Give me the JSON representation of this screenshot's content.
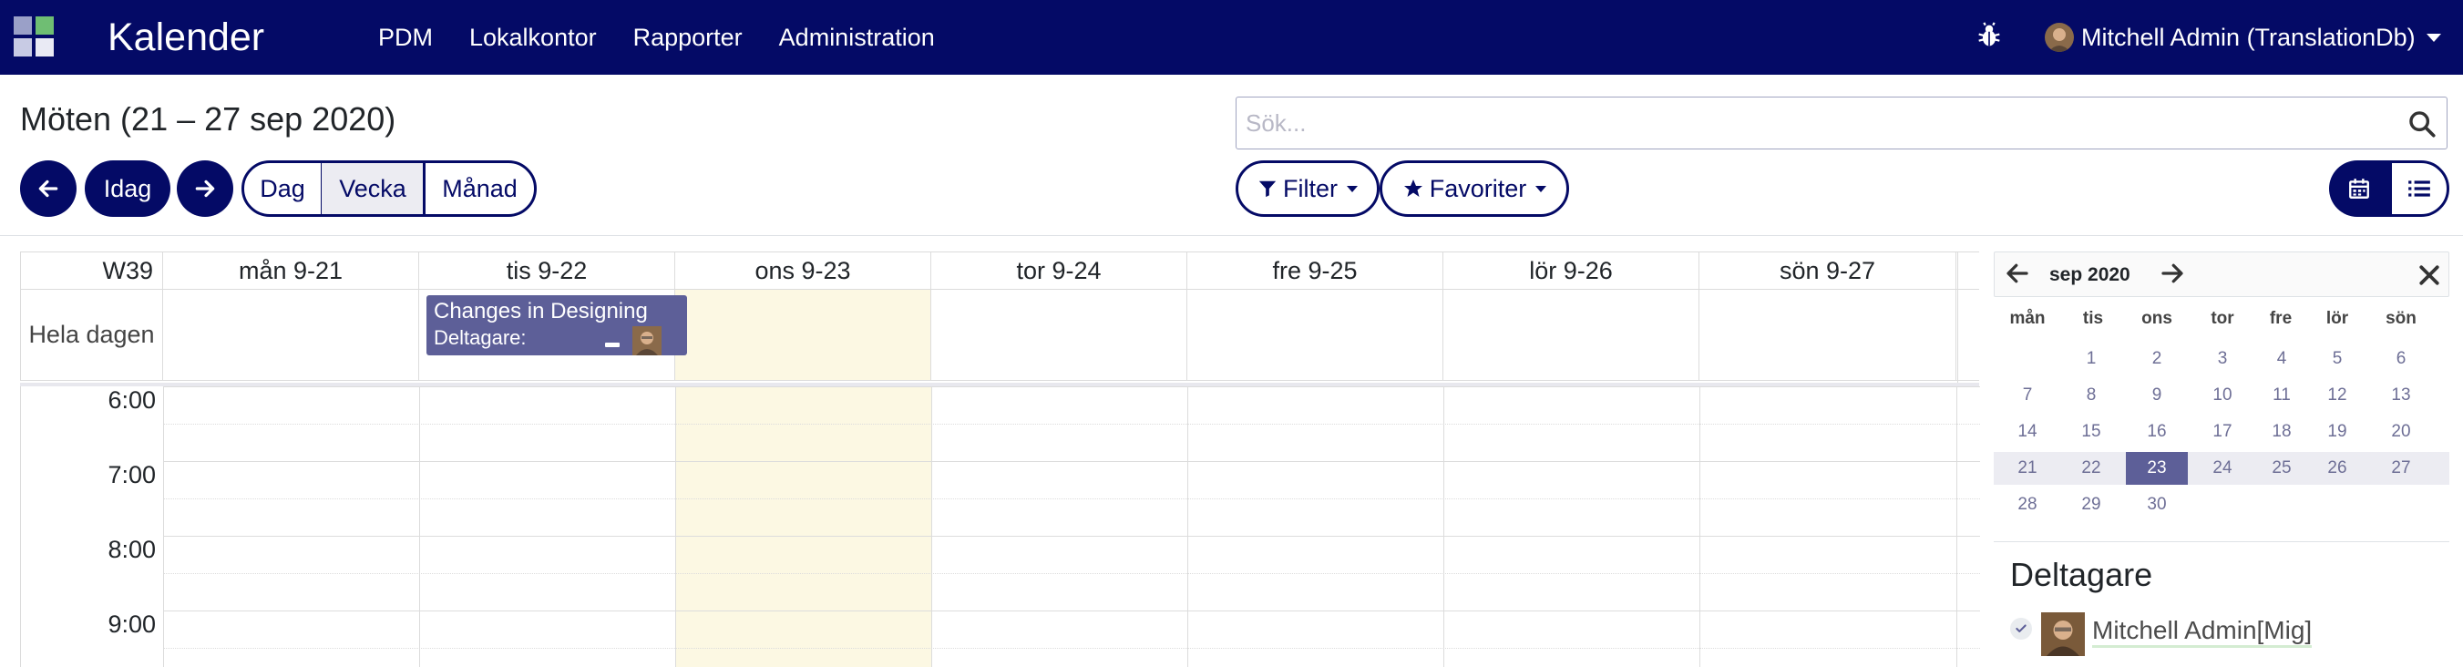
{
  "navbar": {
    "brand": "Kalender",
    "menu": [
      "PDM",
      "Lokalkontor",
      "Rapporter",
      "Administration"
    ],
    "user_name": "Mitchell Admin (TranslationDb)",
    "icons": {
      "apps": "apps-grid-icon",
      "debug": "bug-icon",
      "user_menu": "caret-down-icon"
    },
    "colors": {
      "background": "#040a66",
      "text": "#ffffff"
    }
  },
  "page": {
    "title": "Möten (21 – 27 sep 2020)"
  },
  "search": {
    "placeholder": "Sök...",
    "value": ""
  },
  "toolbar": {
    "prev_icon": "arrow-left-icon",
    "today_label": "Idag",
    "next_icon": "arrow-right-icon",
    "scales": [
      {
        "label": "Dag",
        "active": false
      },
      {
        "label": "Vecka",
        "active": true
      },
      {
        "label": "Månad",
        "active": false
      }
    ],
    "filter_label": "Filter",
    "favorites_label": "Favoriter",
    "views": [
      {
        "icon": "calendar-icon",
        "active": true
      },
      {
        "icon": "list-icon",
        "active": false
      }
    ]
  },
  "calendar": {
    "week_label": "W39",
    "days": [
      "mån 9-21",
      "tis 9-22",
      "ons 9-23",
      "tor 9-24",
      "fre 9-25",
      "lör 9-26",
      "sön 9-27"
    ],
    "today_index": 2,
    "allday_label": "Hela dagen",
    "hours": [
      "6:00",
      "7:00",
      "8:00",
      "9:00"
    ],
    "today_color": "#fcf8e3",
    "events": [
      {
        "title": "Changes in Designing",
        "attendees_label": "Deltagare:",
        "day_index": 1,
        "all_day": true,
        "color": "#5d5f98"
      }
    ]
  },
  "mini_calendar": {
    "month_label": "sep 2020",
    "weekdays": [
      "mån",
      "tis",
      "ons",
      "tor",
      "fre",
      "lör",
      "sön"
    ],
    "weeks": [
      [
        "",
        "1",
        "2",
        "3",
        "4",
        "5",
        "6"
      ],
      [
        "7",
        "8",
        "9",
        "10",
        "11",
        "12",
        "13"
      ],
      [
        "14",
        "15",
        "16",
        "17",
        "18",
        "19",
        "20"
      ],
      [
        "21",
        "22",
        "23",
        "24",
        "25",
        "26",
        "27"
      ],
      [
        "28",
        "29",
        "30",
        "",
        "",
        "",
        ""
      ]
    ],
    "selected_day": "23",
    "highlight_week_index": 3,
    "icons": {
      "prev": "arrow-left-icon",
      "next": "arrow-right-icon",
      "close": "close-icon"
    }
  },
  "attendees": {
    "title": "Deltagare",
    "items": [
      {
        "name": "Mitchell Admin[Mig]",
        "checked": true
      }
    ]
  }
}
